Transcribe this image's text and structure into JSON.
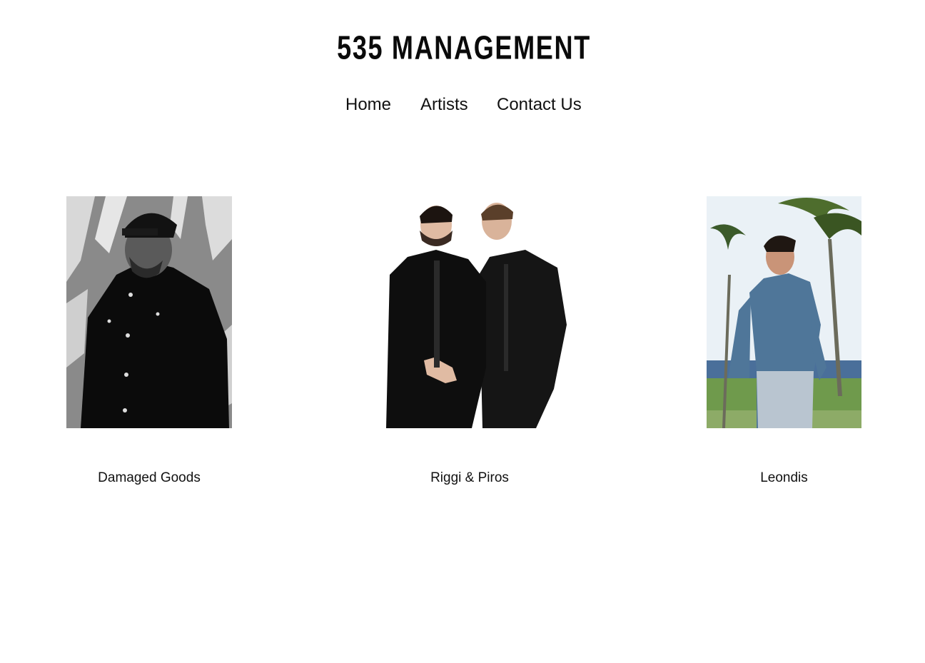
{
  "header": {
    "logo_text": "535 MANAGEMENT"
  },
  "nav": {
    "items": [
      {
        "label": "Home"
      },
      {
        "label": "Artists"
      },
      {
        "label": "Contact Us"
      }
    ]
  },
  "artists": [
    {
      "name": "Damaged Goods",
      "photo_icon": "artist-photo-bw-portrait"
    },
    {
      "name": "Riggi & Piros",
      "photo_icon": "artist-photo-duo"
    },
    {
      "name": "Leondis",
      "photo_icon": "artist-photo-beach-portrait"
    }
  ],
  "colors": {
    "background": "#ffffff",
    "text": "#111111"
  }
}
